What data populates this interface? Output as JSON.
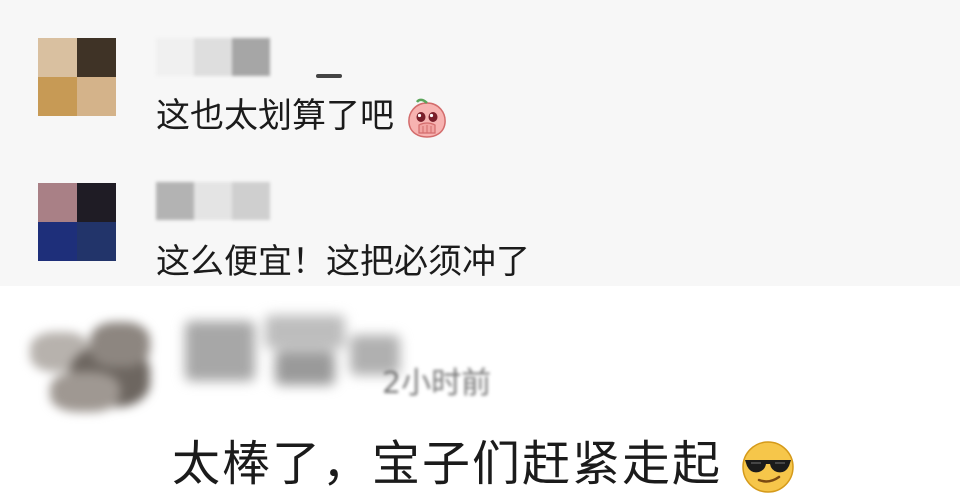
{
  "comments": [
    {
      "text": "这也太划算了吧",
      "emoji": "peach-pleading-emoji",
      "avatar_colors": [
        "#d9c0a0",
        "#3f3326",
        "#c79a55",
        "#d4b38a"
      ],
      "username_colors": [
        "#e6e6e6",
        "#d9d9d9",
        "#a6a6a6"
      ]
    },
    {
      "text": "这么便宜！这把必须冲了",
      "avatar_colors": [
        "#a98086",
        "#1f1c25",
        "#1e2f7a",
        "#22346a"
      ],
      "username_colors": [
        "#b3b3b3",
        "#e4e4e4",
        "#cfcfcf"
      ]
    },
    {
      "time": "2小时前",
      "text": "太棒了，宝子们赶紧走起",
      "emoji": "sunglasses-emoji"
    }
  ]
}
